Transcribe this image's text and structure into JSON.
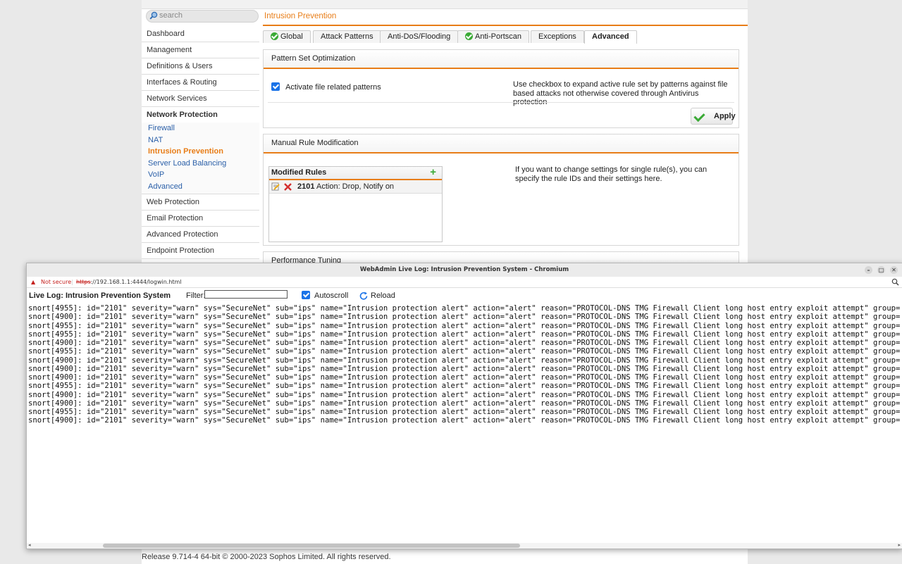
{
  "search": {
    "placeholder": "search"
  },
  "sidebar": {
    "items_top": [
      "Dashboard",
      "Management",
      "Definitions & Users",
      "Interfaces & Routing",
      "Network Services"
    ],
    "section": "Network Protection",
    "sub_items": [
      "Firewall",
      "NAT",
      "Intrusion Prevention",
      "Server Load Balancing",
      "VoIP",
      "Advanced"
    ],
    "active_sub": "Intrusion Prevention",
    "items_bottom": [
      "Web Protection",
      "Email Protection",
      "Advanced Protection",
      "Endpoint Protection"
    ]
  },
  "page": {
    "title": "Intrusion Prevention"
  },
  "tabs": [
    {
      "label": "Global",
      "ok": true
    },
    {
      "label": "Attack Patterns",
      "ok": false
    },
    {
      "label": "Anti-DoS/Flooding",
      "ok": false
    },
    {
      "label": "Anti-Portscan",
      "ok": true
    },
    {
      "label": "Exceptions",
      "ok": false
    },
    {
      "label": "Advanced",
      "ok": false,
      "active": true
    }
  ],
  "pattern_panel": {
    "title": "Pattern Set Optimization",
    "checkbox_label": "Activate file related patterns",
    "checked": true,
    "help": "Use checkbox to expand active rule set by patterns against file based attacks not otherwise covered through Antivirus protection",
    "apply_label": "Apply"
  },
  "manual_panel": {
    "title": "Manual Rule Modification",
    "list_title": "Modified Rules",
    "rule_id": "2101",
    "rule_text": "Action: Drop, Notify on",
    "help": "If you want to change settings for single rule(s), you can specify the rule IDs and their settings here."
  },
  "perf_panel": {
    "title": "Performance Tuning"
  },
  "popup": {
    "window_title": "WebAdmin Live Log: Intrusion Prevention System - Chromium",
    "not_secure": "Not secure",
    "url_scheme": "https",
    "url_rest": "://192.168.1.1:4444/logwin.html",
    "log_title": "Live Log: Intrusion Prevention System",
    "filter_label": "Filter:",
    "filter_value": "",
    "autoscroll_label": "Autoscroll",
    "autoscroll_checked": true,
    "reload_label": "Reload"
  },
  "log_lines": [
    "snort[4955]: id=\"2101\" severity=\"warn\" sys=\"SecureNet\" sub=\"ips\" name=\"Intrusion protection alert\" action=\"alert\" reason=\"PROTOCOL-DNS TMG Firewall Client long host entry exploit attempt\" group=\"2",
    "snort[4900]: id=\"2101\" severity=\"warn\" sys=\"SecureNet\" sub=\"ips\" name=\"Intrusion protection alert\" action=\"alert\" reason=\"PROTOCOL-DNS TMG Firewall Client long host entry exploit attempt\" group=\"2",
    "snort[4955]: id=\"2101\" severity=\"warn\" sys=\"SecureNet\" sub=\"ips\" name=\"Intrusion protection alert\" action=\"alert\" reason=\"PROTOCOL-DNS TMG Firewall Client long host entry exploit attempt\" group=\"2",
    "snort[4955]: id=\"2101\" severity=\"warn\" sys=\"SecureNet\" sub=\"ips\" name=\"Intrusion protection alert\" action=\"alert\" reason=\"PROTOCOL-DNS TMG Firewall Client long host entry exploit attempt\" group=\"2",
    "snort[4900]: id=\"2101\" severity=\"warn\" sys=\"SecureNet\" sub=\"ips\" name=\"Intrusion protection alert\" action=\"alert\" reason=\"PROTOCOL-DNS TMG Firewall Client long host entry exploit attempt\" group=\"2",
    "snort[4955]: id=\"2101\" severity=\"warn\" sys=\"SecureNet\" sub=\"ips\" name=\"Intrusion protection alert\" action=\"alert\" reason=\"PROTOCOL-DNS TMG Firewall Client long host entry exploit attempt\" group=\"2",
    "snort[4900]: id=\"2101\" severity=\"warn\" sys=\"SecureNet\" sub=\"ips\" name=\"Intrusion protection alert\" action=\"alert\" reason=\"PROTOCOL-DNS TMG Firewall Client long host entry exploit attempt\" group=\"2",
    "snort[4900]: id=\"2101\" severity=\"warn\" sys=\"SecureNet\" sub=\"ips\" name=\"Intrusion protection alert\" action=\"alert\" reason=\"PROTOCOL-DNS TMG Firewall Client long host entry exploit attempt\" group=\"2",
    "snort[4900]: id=\"2101\" severity=\"warn\" sys=\"SecureNet\" sub=\"ips\" name=\"Intrusion protection alert\" action=\"alert\" reason=\"PROTOCOL-DNS TMG Firewall Client long host entry exploit attempt\" group=\"2",
    "snort[4955]: id=\"2101\" severity=\"warn\" sys=\"SecureNet\" sub=\"ips\" name=\"Intrusion protection alert\" action=\"alert\" reason=\"PROTOCOL-DNS TMG Firewall Client long host entry exploit attempt\" group=\"2",
    "snort[4900]: id=\"2101\" severity=\"warn\" sys=\"SecureNet\" sub=\"ips\" name=\"Intrusion protection alert\" action=\"alert\" reason=\"PROTOCOL-DNS TMG Firewall Client long host entry exploit attempt\" group=\"2",
    "snort[4900]: id=\"2101\" severity=\"warn\" sys=\"SecureNet\" sub=\"ips\" name=\"Intrusion protection alert\" action=\"alert\" reason=\"PROTOCOL-DNS TMG Firewall Client long host entry exploit attempt\" group=\"2",
    "snort[4955]: id=\"2101\" severity=\"warn\" sys=\"SecureNet\" sub=\"ips\" name=\"Intrusion protection alert\" action=\"alert\" reason=\"PROTOCOL-DNS TMG Firewall Client long host entry exploit attempt\" group=\"2",
    "snort[4900]: id=\"2101\" severity=\"warn\" sys=\"SecureNet\" sub=\"ips\" name=\"Intrusion protection alert\" action=\"alert\" reason=\"PROTOCOL-DNS TMG Firewall Client long host entry exploit attempt\" group=\"2"
  ],
  "footer": "Release 9.714-4 64-bit  © 2000-2023 Sophos Limited. All rights reserved.",
  "colors": {
    "accent": "#e87d17",
    "link": "#2a5fa8",
    "ok": "#3aaa35",
    "delete": "#d32f2f"
  }
}
